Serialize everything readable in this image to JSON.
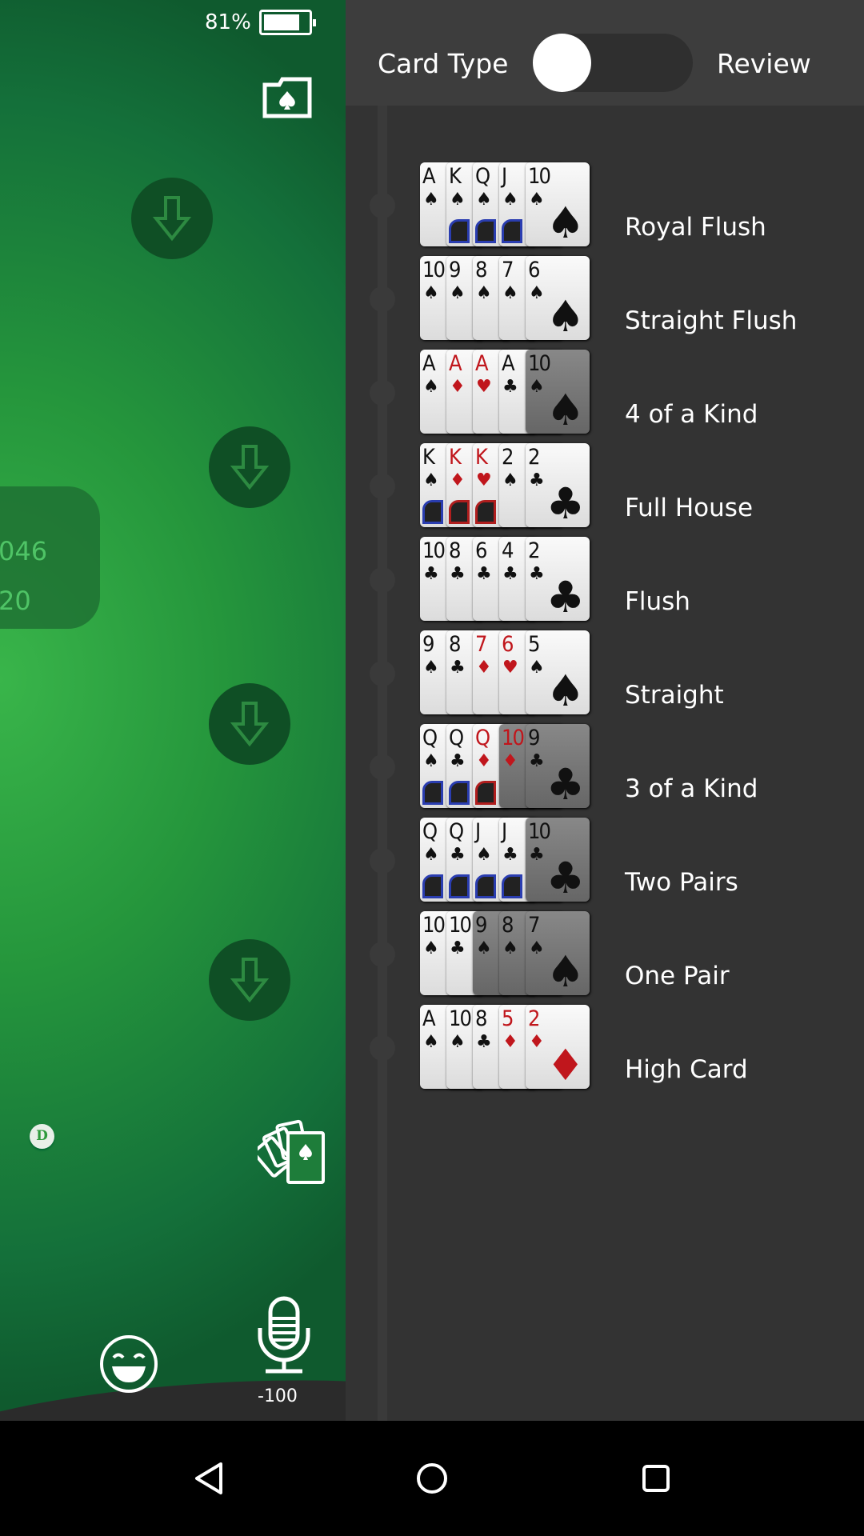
{
  "status": {
    "battery_percent_label": "81%",
    "battery_level": 81
  },
  "table": {
    "ghost_values": [
      "046",
      "20"
    ],
    "dealer_chip": "D",
    "mic_value": "-100",
    "icons": [
      "folder-spade-icon",
      "arrow-down-icon",
      "cards-icon",
      "smiley-icon",
      "microphone-icon"
    ]
  },
  "panel": {
    "left_label": "Card Type",
    "right_label": "Review",
    "toggle_state": "Card Type",
    "hands": [
      {
        "label": "Royal Flush",
        "cards": [
          {
            "r": "A",
            "s": "♠"
          },
          {
            "r": "K",
            "s": "♠",
            "face": "blue"
          },
          {
            "r": "Q",
            "s": "♠",
            "face": "blue"
          },
          {
            "r": "J",
            "s": "♠",
            "face": "blue"
          },
          {
            "r": "10",
            "s": "♠"
          }
        ]
      },
      {
        "label": "Straight Flush",
        "cards": [
          {
            "r": "10",
            "s": "♠"
          },
          {
            "r": "9",
            "s": "♠"
          },
          {
            "r": "8",
            "s": "♠"
          },
          {
            "r": "7",
            "s": "♠"
          },
          {
            "r": "6",
            "s": "♠"
          }
        ]
      },
      {
        "label": "4 of a Kind",
        "cards": [
          {
            "r": "A",
            "s": "♠"
          },
          {
            "r": "A",
            "s": "♦"
          },
          {
            "r": "A",
            "s": "♥"
          },
          {
            "r": "A",
            "s": "♣"
          },
          {
            "r": "10",
            "s": "♠",
            "dim": true
          }
        ]
      },
      {
        "label": "Full House",
        "cards": [
          {
            "r": "K",
            "s": "♠",
            "face": "blue"
          },
          {
            "r": "K",
            "s": "♦",
            "face": "red"
          },
          {
            "r": "K",
            "s": "♥",
            "face": "red"
          },
          {
            "r": "2",
            "s": "♠"
          },
          {
            "r": "2",
            "s": "♣"
          }
        ]
      },
      {
        "label": "Flush",
        "cards": [
          {
            "r": "10",
            "s": "♣"
          },
          {
            "r": "8",
            "s": "♣"
          },
          {
            "r": "6",
            "s": "♣"
          },
          {
            "r": "4",
            "s": "♣"
          },
          {
            "r": "2",
            "s": "♣"
          }
        ]
      },
      {
        "label": "Straight",
        "cards": [
          {
            "r": "9",
            "s": "♠"
          },
          {
            "r": "8",
            "s": "♣"
          },
          {
            "r": "7",
            "s": "♦"
          },
          {
            "r": "6",
            "s": "♥"
          },
          {
            "r": "5",
            "s": "♠"
          }
        ]
      },
      {
        "label": "3 of a Kind",
        "cards": [
          {
            "r": "Q",
            "s": "♠",
            "face": "blue"
          },
          {
            "r": "Q",
            "s": "♣",
            "face": "blue"
          },
          {
            "r": "Q",
            "s": "♦",
            "face": "red"
          },
          {
            "r": "10",
            "s": "♦",
            "dim": true
          },
          {
            "r": "9",
            "s": "♣",
            "dim": true
          }
        ]
      },
      {
        "label": "Two Pairs",
        "cards": [
          {
            "r": "Q",
            "s": "♠",
            "face": "blue"
          },
          {
            "r": "Q",
            "s": "♣",
            "face": "blue"
          },
          {
            "r": "J",
            "s": "♠",
            "face": "blue"
          },
          {
            "r": "J",
            "s": "♣",
            "face": "blue"
          },
          {
            "r": "10",
            "s": "♣",
            "dim": true
          }
        ]
      },
      {
        "label": "One Pair",
        "cards": [
          {
            "r": "10",
            "s": "♠"
          },
          {
            "r": "10",
            "s": "♣"
          },
          {
            "r": "9",
            "s": "♠",
            "dim": true
          },
          {
            "r": "8",
            "s": "♠",
            "dim": true
          },
          {
            "r": "7",
            "s": "♠",
            "dim": true
          }
        ]
      },
      {
        "label": "High Card",
        "cards": [
          {
            "r": "A",
            "s": "♠"
          },
          {
            "r": "10",
            "s": "♠"
          },
          {
            "r": "8",
            "s": "♣"
          },
          {
            "r": "5",
            "s": "♦"
          },
          {
            "r": "2",
            "s": "♦"
          }
        ]
      }
    ]
  },
  "nav": {
    "icons": [
      "back-icon",
      "home-icon",
      "recents-icon"
    ]
  },
  "colors": {
    "felt": "#25963c",
    "panel": "#333333",
    "header": "#3d3d3d",
    "red_suit": "#c0161c",
    "face_blue": "#2a3db0",
    "face_red": "#b01e1e"
  }
}
